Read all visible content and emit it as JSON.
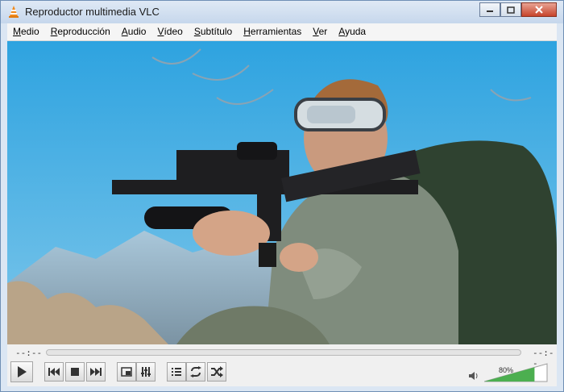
{
  "window": {
    "title": "Reproductor multimedia VLC"
  },
  "menu": [
    {
      "u": "M",
      "rest": "edio"
    },
    {
      "u": "R",
      "rest": "eproducción"
    },
    {
      "u": "A",
      "rest": "udio"
    },
    {
      "u": "V",
      "rest": "ídeo"
    },
    {
      "u": "S",
      "rest": "ubtítulo"
    },
    {
      "u": "H",
      "rest": "erramientas"
    },
    {
      "u": "V",
      "rest": "er"
    },
    {
      "u": "A",
      "rest": "yuda"
    }
  ],
  "playback": {
    "elapsed": "--:--",
    "remaining": "--:--",
    "progress": 0
  },
  "volume": {
    "label": "80%",
    "level": 0.8
  },
  "icons": {
    "app": "vlc-cone-icon",
    "play": "play-icon",
    "prev": "previous-icon",
    "stop": "stop-icon",
    "next": "next-icon",
    "fullscreen": "fullscreen-icon",
    "equalizer": "equalizer-icon",
    "playlist": "playlist-icon",
    "loop": "loop-icon",
    "shuffle": "shuffle-icon",
    "speaker": "speaker-icon"
  },
  "colors": {
    "accent": "#4caf50",
    "sky": "#3aa8e0"
  }
}
